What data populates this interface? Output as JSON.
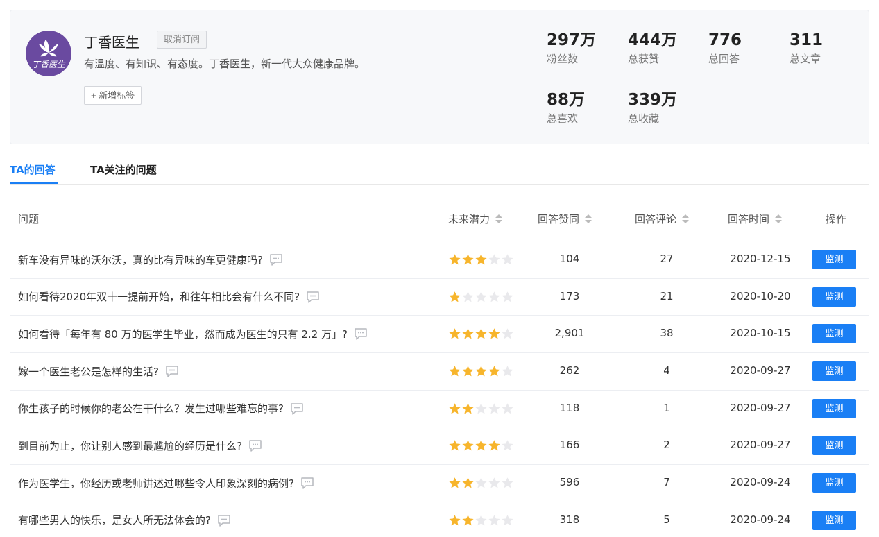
{
  "profile": {
    "name": "丁香医生",
    "avatar_text": "丁香医生",
    "unsubscribe_label": "取消订阅",
    "bio": "有温度、有知识、有态度。丁香医生，新一代大众健康品牌。",
    "add_tag_label": "+ 新增标签",
    "brand_color": "#6a4aa0",
    "stats": [
      {
        "value": "297万",
        "label": "粉丝数"
      },
      {
        "value": "444万",
        "label": "总获赞"
      },
      {
        "value": "776",
        "label": "总回答"
      },
      {
        "value": "311",
        "label": "总文章"
      },
      {
        "value": "88万",
        "label": "总喜欢"
      },
      {
        "value": "339万",
        "label": "总收藏"
      }
    ]
  },
  "tabs": [
    {
      "label": "TA的回答",
      "active": true
    },
    {
      "label": "TA关注的问题",
      "active": false
    }
  ],
  "table": {
    "headers": {
      "question": "问题",
      "potential": "未来潜力",
      "likes": "回答赞同",
      "comments": "回答评论",
      "date": "回答时间",
      "action": "操作"
    },
    "action_label": "监测",
    "accent_color": "#1a7ff5",
    "star_color": "#f7b52c",
    "rows": [
      {
        "question": "新车没有异味的沃尔沃，真的比有异味的车更健康吗?",
        "stars": 3,
        "likes": "104",
        "comments": "27",
        "date": "2020-12-15"
      },
      {
        "question": "如何看待2020年双十一提前开始，和往年相比会有什么不同?",
        "stars": 1,
        "likes": "173",
        "comments": "21",
        "date": "2020-10-20"
      },
      {
        "question": "如何看待「每年有 80 万的医学生毕业，然而成为医生的只有 2.2 万」?",
        "stars": 4,
        "likes": "2,901",
        "comments": "38",
        "date": "2020-10-15"
      },
      {
        "question": "嫁一个医生老公是怎样的生活?",
        "stars": 4,
        "likes": "262",
        "comments": "4",
        "date": "2020-09-27"
      },
      {
        "question": "你生孩子的时候你的老公在干什么？发生过哪些难忘的事?",
        "stars": 2,
        "likes": "118",
        "comments": "1",
        "date": "2020-09-27"
      },
      {
        "question": "到目前为止，你让别人感到最尴尬的经历是什么?",
        "stars": 4,
        "likes": "166",
        "comments": "2",
        "date": "2020-09-27"
      },
      {
        "question": "作为医学生，你经历或老师讲述过哪些令人印象深刻的病例?",
        "stars": 2,
        "likes": "596",
        "comments": "7",
        "date": "2020-09-24"
      },
      {
        "question": "有哪些男人的快乐，是女人所无法体会的?",
        "stars": 2,
        "likes": "318",
        "comments": "5",
        "date": "2020-09-24"
      }
    ]
  }
}
